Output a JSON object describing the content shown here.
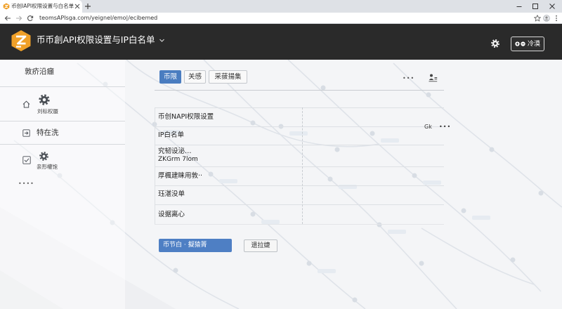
{
  "browser": {
    "tab_title": "币创IAPI权限设置与白名单",
    "url": "teomsAPIsga.com/yeignel/emo|/ecibemed",
    "icons": [
      "favicon-icon",
      "close-tab-icon",
      "new-tab-icon",
      "minimize-icon",
      "maximize-icon",
      "close-window-icon",
      "back-arrow-icon",
      "forward-arrow-icon",
      "reload-icon",
      "star-icon",
      "profile-icon",
      "menu-dots-icon"
    ]
  },
  "header": {
    "title": "币币創API权限设置与IP白名单",
    "button_label": "冷漠",
    "icons": [
      "logo-icon",
      "chevron-down-icon",
      "gear-icon",
      "add-circle-icon",
      "remove-circle-icon"
    ]
  },
  "sidebar": {
    "title": "敦疥沿癰",
    "items": [
      {
        "label": "刘标权蜃",
        "icon": "home-gear-icon"
      },
      {
        "label": "特在洗",
        "icon": "arrow-in-box-icon"
      },
      {
        "label": "亲形權饱",
        "icon": "checkbox-gear-icon"
      }
    ],
    "more": "••••"
  },
  "main": {
    "tabs": [
      {
        "label": "币限",
        "active": true
      },
      {
        "label": "关感",
        "active": false
      },
      {
        "label": "采菝揚集",
        "active": false
      }
    ],
    "toolbar_more": "•••",
    "toolbar_icon": "user-list-icon",
    "rows": [
      {
        "label": "币创NAPI权限设置"
      },
      {
        "label": "IP白名单",
        "side_badge": "Gk",
        "side_more": "•••"
      },
      {
        "label": "究韧设泌…",
        "sub": "ZKGrm 7lom"
      },
      {
        "label": "厚楓建睐用敦··"
      },
      {
        "label": "珏湛没单"
      },
      {
        "label": "设据离心"
      }
    ],
    "actions": {
      "primary": "币节白 · 擬猿箐",
      "secondary": "遗拉婕"
    }
  },
  "colors": {
    "header_bg": "#2a2a2a",
    "accent": "#4a7dc0",
    "logo": "#f0a028",
    "page_bg": "#f4f5f7"
  }
}
